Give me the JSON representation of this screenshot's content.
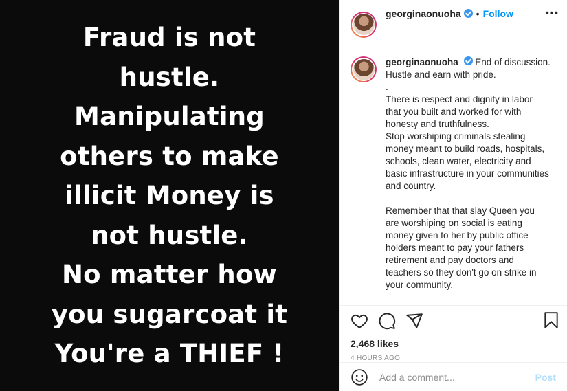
{
  "image": {
    "lines": [
      "Fraud is not",
      "hustle.",
      "Manipulating",
      "others to make",
      "illicit Money is",
      "not hustle.",
      "No matter how",
      "you sugarcoat it",
      "You're a THIEF !"
    ]
  },
  "header": {
    "username": "georginaonuoha",
    "separator": "•",
    "follow_label": "Follow",
    "more_label": "•••"
  },
  "caption": {
    "username": "georginaonuoha",
    "paragraphs": [
      "End of discussion. Hustle and earn with pride.",
      ".",
      "There is respect and dignity in labor that you built and worked for with honesty and truthfulness.",
      "Stop worshiping criminals stealing money meant to build roads, hospitals, schools, clean water, electricity and basic infrastructure in your communities and country.",
      "",
      "Remember that that slay Queen you are worshiping on social is eating money given to her by public office holders meant to pay your fathers retirement and pay doctors and teachers so they don't go on strike in your community."
    ]
  },
  "stats": {
    "likes": "2,468 likes",
    "timestamp": "4 HOURS AGO"
  },
  "comment_box": {
    "placeholder": "Add a comment...",
    "post_label": "Post"
  },
  "colors": {
    "accent": "#0095f6",
    "post_disabled": "#b2dffc",
    "verified": "#3897f0"
  },
  "icons": {
    "like": "heart-icon",
    "comment": "comment-icon",
    "share": "share-icon",
    "save": "bookmark-icon",
    "emoji": "emoji-icon"
  }
}
